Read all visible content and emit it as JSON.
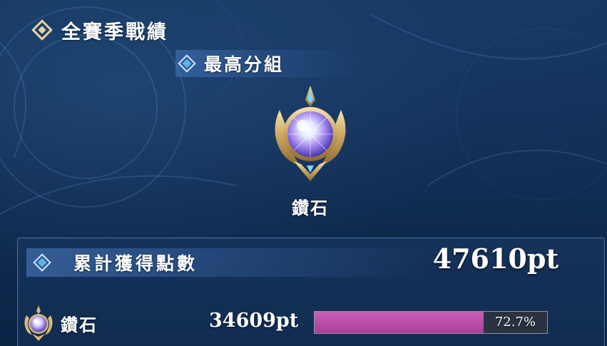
{
  "section": {
    "title": "全賽季戰績",
    "icon": "diamond-frame-icon"
  },
  "highest_tier": {
    "label": "最高分組",
    "rank_name": "鑽石",
    "emblem": "diamond-rank-emblem"
  },
  "points": {
    "label": "累計獲得點數",
    "total": "47610pt"
  },
  "tier_rows": [
    {
      "name": "鑽石",
      "points": "34609pt",
      "percent_text": "72.7%",
      "percent_value": 72.7,
      "bar_color": "#b84ca6"
    }
  ],
  "colors": {
    "background": "#12325a",
    "accent_gold": "#d8b978",
    "accent_blue": "#5fb3e8",
    "progress_fill": "#b84ca6"
  }
}
